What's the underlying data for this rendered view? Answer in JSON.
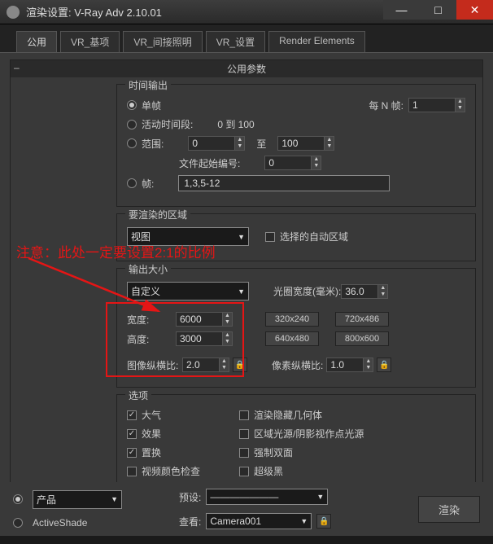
{
  "window": {
    "title": "渲染设置: V-Ray Adv 2.10.01"
  },
  "tabs": [
    "公用",
    "VR_基项",
    "VR_间接照明",
    "VR_设置",
    "Render Elements"
  ],
  "section_title": "公用参数",
  "time_output": {
    "label": "时间输出",
    "single_frame": "单帧",
    "every_n": "每 N 帧:",
    "every_n_val": "1",
    "active_segment": "活动时间段:",
    "active_range": "0 到 100",
    "range": "范围:",
    "range_from": "0",
    "range_to_label": "至",
    "range_to": "100",
    "file_start": "文件起始编号:",
    "file_start_val": "0",
    "frames": "帧:",
    "frames_val": "1,3,5-12"
  },
  "render_area": {
    "label": "要渲染的区域",
    "value": "视图",
    "auto_region": "选择的自动区域"
  },
  "output_size": {
    "label": "输出大小",
    "custom": "自定义",
    "aperture_label": "光圈宽度(毫米):",
    "aperture_val": "36.0",
    "width_label": "宽度:",
    "width_val": "6000",
    "height_label": "高度:",
    "height_val": "3000",
    "preset1": "320x240",
    "preset2": "720x486",
    "preset3": "640x480",
    "preset4": "800x600",
    "img_aspect_label": "图像纵横比:",
    "img_aspect_val": "2.0",
    "pixel_aspect_label": "像素纵横比:",
    "pixel_aspect_val": "1.0"
  },
  "options": {
    "label": "选项",
    "atmos": "大气",
    "hidden_geom": "渲染隐藏几何体",
    "effects": "效果",
    "area_light": "区域光源/阴影视作点光源",
    "displace": "置换",
    "force2side": "强制双面",
    "video_color": "视频颜色检查",
    "superblack": "超级黑"
  },
  "footer": {
    "product": "产品",
    "activeshade": "ActiveShade",
    "preset_label": "预设:",
    "viewport_label": "查看:",
    "viewport_val": "Camera001",
    "render_btn": "渲染"
  },
  "annotation": {
    "text": "注意：此处一定要设置2:1的比例"
  }
}
